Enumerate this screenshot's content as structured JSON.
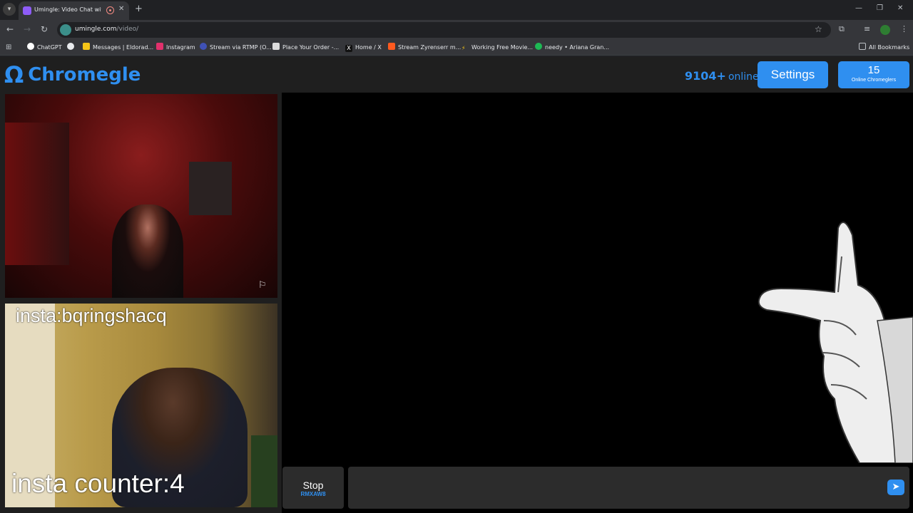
{
  "browser": {
    "tab_title": "Umingle: Video Chat with S",
    "new_tab_symbol": "+",
    "url_host": "umingle.com",
    "url_path": "/video/",
    "bookmarks": [
      {
        "label": "ChatGPT",
        "icon": "chatgpt-icon",
        "color": "#ffffff"
      },
      {
        "label": "Messages | Eldorad...",
        "icon": "eldorado-icon",
        "color": "#f5c518"
      },
      {
        "label": "Instagram",
        "icon": "instagram-icon",
        "color": "#e1306c"
      },
      {
        "label": "Stream via RTMP (O...",
        "icon": "rtmp-icon",
        "color": "#3f51b5"
      },
      {
        "label": "Place Your Order -...",
        "icon": "order-icon",
        "color": "#dddddd"
      },
      {
        "label": "Home / X",
        "icon": "x-icon",
        "color": "#000000"
      },
      {
        "label": "Stream Zyrenserr m...",
        "icon": "stream-icon",
        "color": "#ff5a1f"
      },
      {
        "label": "Working Free Movie...",
        "icon": "movie-icon",
        "color": "#f5c518"
      },
      {
        "label": "needy • Ariana Gran...",
        "icon": "spotify-icon",
        "color": "#1db954"
      }
    ],
    "all_bookmarks": "All Bookmarks"
  },
  "site": {
    "logo_symbol": "Ω",
    "logo_text": "Chromegle",
    "online_count": "9104+",
    "online_label": "online",
    "settings_label": "Settings",
    "chromeglers_count": "15",
    "chromeglers_label": "Online Chromeglers",
    "brand_color": "#2f8ff0"
  },
  "videos": {
    "self_overlay_top": "insta:bqringshacq",
    "self_overlay_bottom": "insta counter:4"
  },
  "controls": {
    "stop_label": "Stop",
    "stop_key": "RMXAW8",
    "chat_placeholder": ""
  }
}
